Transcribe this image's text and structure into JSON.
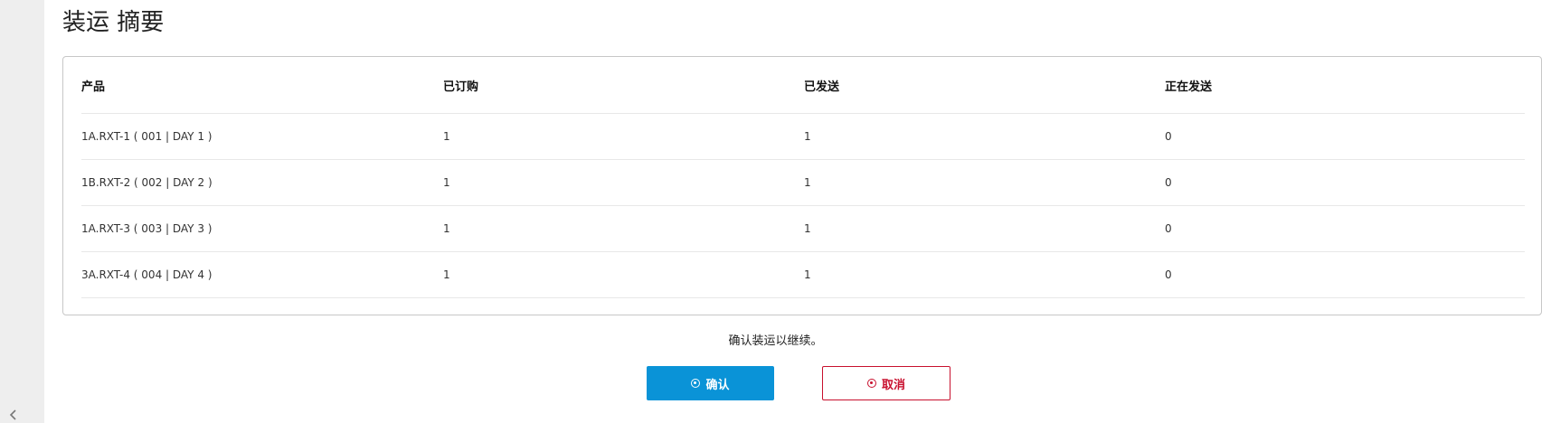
{
  "page": {
    "title": "装运 摘要"
  },
  "table": {
    "headers": [
      "产品",
      "已订购",
      "已发送",
      "正在发送"
    ],
    "rows": [
      {
        "product": "1A.RXT-1 ( 001 | DAY 1 )",
        "ordered": "1",
        "shipped": "1",
        "shipping": "0"
      },
      {
        "product": "1B.RXT-2 ( 002 | DAY 2 )",
        "ordered": "1",
        "shipped": "1",
        "shipping": "0"
      },
      {
        "product": "1A.RXT-3 ( 003 | DAY 3 )",
        "ordered": "1",
        "shipped": "1",
        "shipping": "0"
      },
      {
        "product": "3A.RXT-4 ( 004 | DAY 4 )",
        "ordered": "1",
        "shipped": "1",
        "shipping": "0"
      }
    ]
  },
  "footer": {
    "note": "确认装运以继续。",
    "confirm_label": "确认",
    "cancel_label": "取消"
  },
  "icons": {
    "confirm": "circle-arrow-icon",
    "cancel": "circle-arrow-icon",
    "collapse": "chevron-left-icon"
  },
  "colors": {
    "primary": "#0a93d7",
    "danger": "#c8102e",
    "sidebar": "#eeeeee"
  }
}
